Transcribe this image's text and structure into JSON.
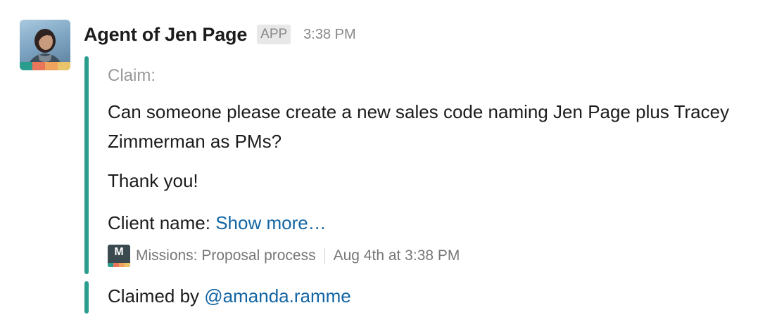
{
  "message": {
    "sender_name": "Agent of Jen Page",
    "app_badge": "APP",
    "timestamp": "3:38 PM",
    "avatar_icon": "user-avatar-photo"
  },
  "attachment": {
    "accent_color": "#2a9d8f",
    "title": "Claim:",
    "body": "Can someone please create a new sales code naming  Jen Page plus Tracey Zimmerman as PMs?",
    "thanks": "Thank you!",
    "client_label": "Client name: ",
    "show_more": "Show more…",
    "footer": {
      "icon_letter": "M",
      "source": "Missions: Proposal process",
      "date": "Aug 4th at 3:38 PM"
    }
  },
  "claimed": {
    "prefix": "Claimed by ",
    "user": "@amanda.ramme"
  },
  "colors": {
    "link": "#1264a3",
    "stripe": [
      "#2a9d8f",
      "#e9765b",
      "#f0a35e",
      "#e9c46a"
    ]
  }
}
